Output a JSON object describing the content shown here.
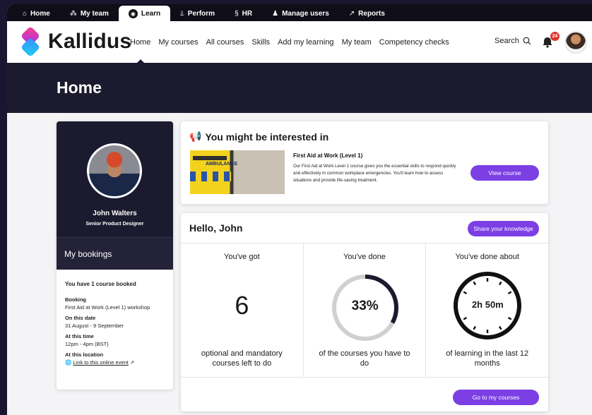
{
  "topnav": {
    "tabs": [
      {
        "label": "Home",
        "icon": "home-icon",
        "glyph": "⌂"
      },
      {
        "label": "My team",
        "icon": "team-icon",
        "glyph": "⁂"
      },
      {
        "label": "Learn",
        "icon": "learn-icon",
        "glyph": "◉"
      },
      {
        "label": "Perform",
        "icon": "chart-icon",
        "glyph": "⫫"
      },
      {
        "label": "HR",
        "icon": "hr-icon",
        "glyph": "§"
      },
      {
        "label": "Manage users",
        "icon": "users-icon",
        "glyph": "♟"
      },
      {
        "label": "Reports",
        "icon": "reports-icon",
        "glyph": "↗"
      }
    ],
    "active": "Learn"
  },
  "header": {
    "brand": "Kallidus",
    "nav": [
      "Home",
      "My courses",
      "All courses",
      "Skills",
      "Add my learning",
      "My team",
      "Competency checks"
    ],
    "active_nav": "Home",
    "search_label": "Search",
    "notification_count": "24"
  },
  "hero": {
    "title": "Home"
  },
  "profile": {
    "name": "John Walters",
    "role": "Senior Product Designer"
  },
  "bookings": {
    "title": "My bookings",
    "summary": "You have 1 course booked",
    "booking_label": "Booking",
    "booking_value": "First Aid at Work (Level 1) workshop",
    "date_label": "On this date",
    "date_value": "31 August - 9 September",
    "time_label": "At this time",
    "time_value": "12pm - 4pm (BST)",
    "location_label": "At this location",
    "location_link": "Link to this online event"
  },
  "interest": {
    "title": "You might be interested in",
    "image_text": "AMBULANCE",
    "course_title": "First Aid at Work (Level 1)",
    "course_desc": "Our First Aid at Work Level 1 course gives you the essential skills to respond quickly and effectively in common workplace emergencies. You'll learn how to assess situations and provide life-saving treatment.",
    "button": "View course"
  },
  "hello": {
    "title": "Hello, John",
    "share_button": "Share your knowledge",
    "stats": [
      {
        "head": "You've got",
        "value": "6",
        "foot": "optional and mandatory courses left to do"
      },
      {
        "head": "You've done",
        "value": "33%",
        "percent": 33,
        "foot": "of the courses you have to do"
      },
      {
        "head": "You've done about",
        "value": "2h 50m",
        "foot": "of learning in the last 12 months"
      }
    ],
    "goto_button": "Go to my courses"
  },
  "colors": {
    "accent": "#7b3fe4",
    "dark": "#1b1a2e",
    "badge": "#e0322c"
  }
}
